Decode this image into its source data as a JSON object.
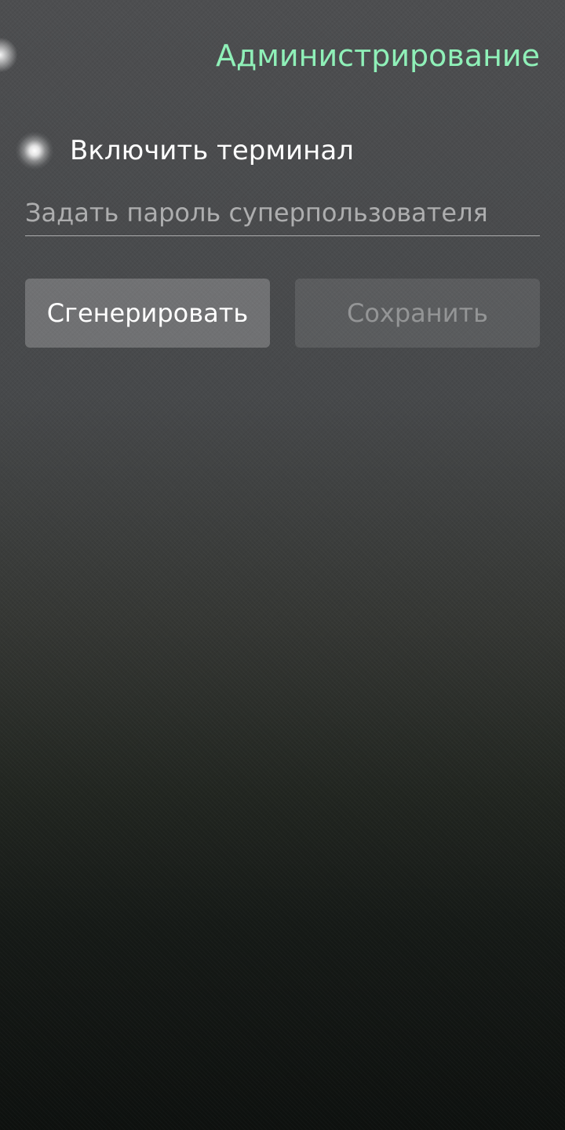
{
  "header": {
    "title": "Администрирование"
  },
  "terminal_switch": {
    "label": "Включить терминал",
    "checked": true
  },
  "password": {
    "value": "",
    "placeholder": "Задать пароль суперпользователя"
  },
  "actions": {
    "generate_label": "Сгенерировать",
    "save_label": "Сохранить",
    "save_enabled": false
  },
  "colors": {
    "accent": "#8ff0b8",
    "text": "#ffffff"
  }
}
